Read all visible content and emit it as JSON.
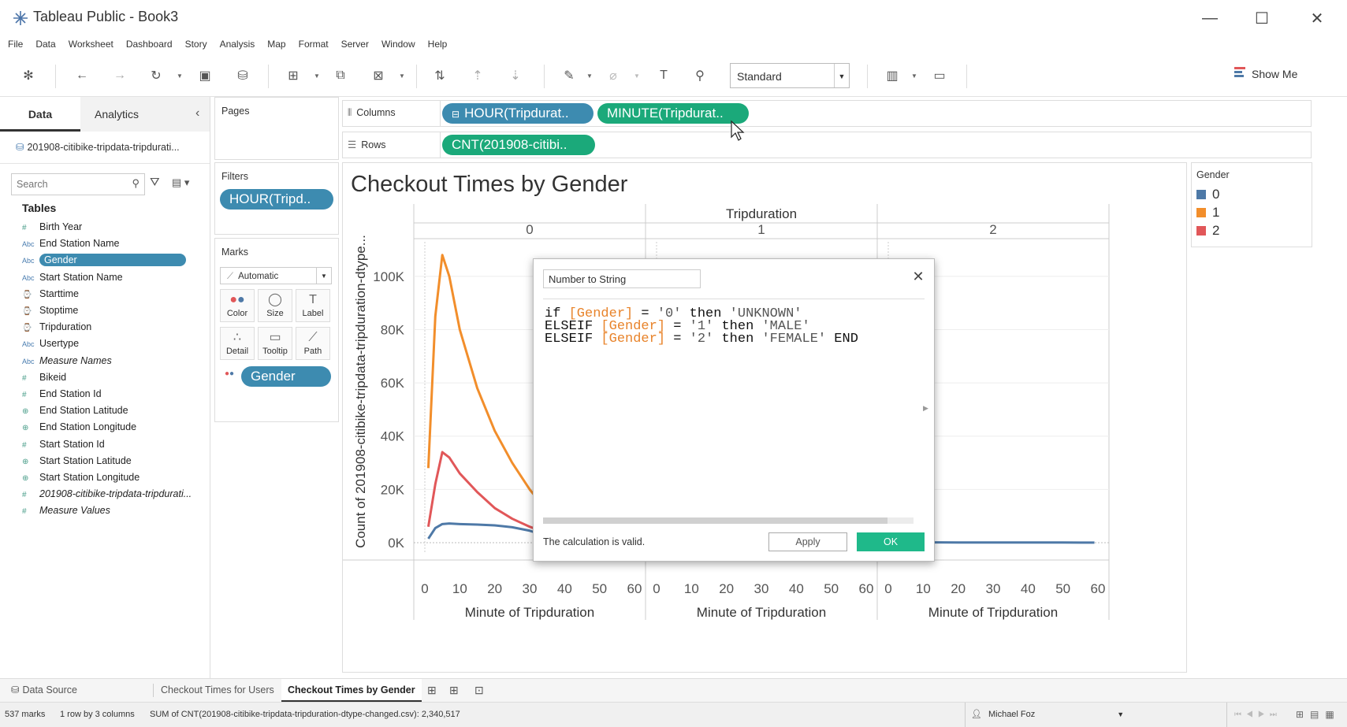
{
  "window": {
    "title": "Tableau Public - Book3",
    "controls": {
      "minimize": "—",
      "maximize": "☐",
      "close": "✕"
    }
  },
  "menu": [
    "File",
    "Data",
    "Worksheet",
    "Dashboard",
    "Story",
    "Analysis",
    "Map",
    "Format",
    "Server",
    "Window",
    "Help"
  ],
  "toolbar": {
    "fit_select": "Standard",
    "show_me": "Show Me"
  },
  "data_pane": {
    "tabs": [
      "Data",
      "Analytics"
    ],
    "collapse": "‹",
    "datasource": "201908-citibike-tripdata-tripdurati...",
    "search_placeholder": "Search",
    "tables_heading": "Tables",
    "fields": [
      {
        "icon": "#",
        "name": "Birth Year",
        "italic": false
      },
      {
        "icon": "Abc",
        "name": "End Station Name",
        "italic": false
      },
      {
        "icon": "Abc",
        "name": "Gender",
        "italic": false,
        "selected": true
      },
      {
        "icon": "Abc",
        "name": "Start Station Name",
        "italic": false
      },
      {
        "icon": "⌚",
        "name": "Starttime",
        "italic": false
      },
      {
        "icon": "⌚",
        "name": "Stoptime",
        "italic": false
      },
      {
        "icon": "⌚",
        "name": "Tripduration",
        "italic": false
      },
      {
        "icon": "Abc",
        "name": "Usertype",
        "italic": false
      },
      {
        "icon": "Abc",
        "name": "Measure Names",
        "italic": true
      },
      {
        "icon": "#",
        "name": "Bikeid",
        "italic": false
      },
      {
        "icon": "#",
        "name": "End Station Id",
        "italic": false
      },
      {
        "icon": "⊕",
        "name": "End Station Latitude",
        "italic": false
      },
      {
        "icon": "⊕",
        "name": "End Station Longitude",
        "italic": false
      },
      {
        "icon": "#",
        "name": "Start Station Id",
        "italic": false
      },
      {
        "icon": "⊕",
        "name": "Start Station Latitude",
        "italic": false
      },
      {
        "icon": "⊕",
        "name": "Start Station Longitude",
        "italic": false
      },
      {
        "icon": "#",
        "name": "201908-citibike-tripdata-tripdurati...",
        "italic": true
      },
      {
        "icon": "#",
        "name": "Measure Values",
        "italic": true
      }
    ]
  },
  "cards": {
    "pages_title": "Pages",
    "filters_title": "Filters",
    "filter_pill": "HOUR(Tripd..",
    "marks_title": "Marks",
    "mark_type": "Automatic",
    "mark_buttons": [
      "Color",
      "Size",
      "Label",
      "Detail",
      "Tooltip",
      "Path"
    ],
    "color_pill": "Gender"
  },
  "shelves": {
    "columns_label": "Columns",
    "rows_label": "Rows",
    "columns_pills": [
      "HOUR(Tripdurat..",
      "MINUTE(Tripdurat.."
    ],
    "rows_pills": [
      "CNT(201908-citibi.."
    ]
  },
  "legend": {
    "title": "Gender",
    "items": [
      {
        "label": "0",
        "color": "#4e79a7"
      },
      {
        "label": "1",
        "color": "#f28e2b"
      },
      {
        "label": "2",
        "color": "#e15759"
      }
    ]
  },
  "chart_data": {
    "type": "line",
    "title": "Checkout Times by Gender",
    "column_header": "Tripduration",
    "panes": [
      "0",
      "1",
      "2"
    ],
    "xlabel": "Minute of Tripduration",
    "ylabel": "Count of 201908-citibike-tripdata-tripduration-dtype...",
    "xlim": [
      0,
      60
    ],
    "ylim": [
      0,
      110000
    ],
    "x_ticks": [
      "0",
      "10",
      "20",
      "30",
      "40",
      "50",
      "60"
    ],
    "y_ticks": [
      "0K",
      "20K",
      "40K",
      "60K",
      "80K",
      "100K"
    ],
    "y_tick_values": [
      0,
      20000,
      40000,
      60000,
      80000,
      100000
    ],
    "x": [
      1,
      3,
      5,
      7,
      10,
      15,
      20,
      25,
      30,
      35,
      40,
      45,
      50,
      55,
      59
    ],
    "series": [
      {
        "name": "1",
        "color": "#f28e2b",
        "pane": "0",
        "values": [
          28000,
          85000,
          108000,
          100000,
          80000,
          58000,
          42000,
          30000,
          20000,
          12000,
          6500,
          3000,
          1500,
          800,
          500
        ]
      },
      {
        "name": "2",
        "color": "#e15759",
        "pane": "0",
        "values": [
          6000,
          22000,
          34000,
          32000,
          26000,
          19000,
          13000,
          9000,
          6000,
          3500,
          2000,
          1000,
          600,
          300,
          200
        ]
      },
      {
        "name": "0",
        "color": "#4e79a7",
        "pane": "0",
        "values": [
          1500,
          5500,
          7000,
          7200,
          7000,
          6800,
          6500,
          5800,
          4500,
          2500,
          1500,
          800,
          500,
          300,
          200
        ]
      },
      {
        "name": "0",
        "color": "#4e79a7",
        "pane": "1",
        "values": [
          300,
          280,
          260,
          240,
          220,
          200,
          190,
          180,
          170,
          160,
          150,
          140,
          130,
          120,
          110
        ]
      },
      {
        "name": "0",
        "color": "#4e79a7",
        "pane": "2",
        "values": [
          120,
          115,
          110,
          105,
          100,
          95,
          90,
          85,
          80,
          75,
          70,
          65,
          60,
          55,
          50
        ]
      }
    ]
  },
  "dialog": {
    "name": "Number to String",
    "close": "✕",
    "code_lines": [
      [
        [
          "kw",
          "if "
        ],
        [
          "fld",
          "[Gender]"
        ],
        [
          "kw",
          " = "
        ],
        [
          "str",
          "'0'"
        ],
        [
          "kw",
          " then "
        ],
        [
          "str",
          "'UNKNOWN'"
        ]
      ],
      [
        [
          "kw",
          "ELSEIF "
        ],
        [
          "fld",
          "[Gender]"
        ],
        [
          "kw",
          " = "
        ],
        [
          "str",
          "'1'"
        ],
        [
          "kw",
          " then "
        ],
        [
          "str",
          "'MALE'"
        ]
      ],
      [
        [
          "kw",
          "ELSEIF "
        ],
        [
          "fld",
          "[Gender]"
        ],
        [
          "kw",
          " = "
        ],
        [
          "str",
          "'2'"
        ],
        [
          "kw",
          " then "
        ],
        [
          "str",
          "'FEMALE'"
        ],
        [
          "kw",
          " END"
        ]
      ]
    ],
    "validation": "The calculation is valid.",
    "apply": "Apply",
    "ok": "OK"
  },
  "sheet_tabs": {
    "data_source": "Data Source",
    "tabs": [
      "Checkout Times for Users",
      "Checkout Times by Gender"
    ],
    "active": "Checkout Times by Gender"
  },
  "status": {
    "marks": "537 marks",
    "dims": "1 row by 3 columns",
    "sum": "SUM of CNT(201908-citibike-tripdata-tripduration-dtype-changed.csv): 2,340,517",
    "user": "Michael Foz"
  }
}
